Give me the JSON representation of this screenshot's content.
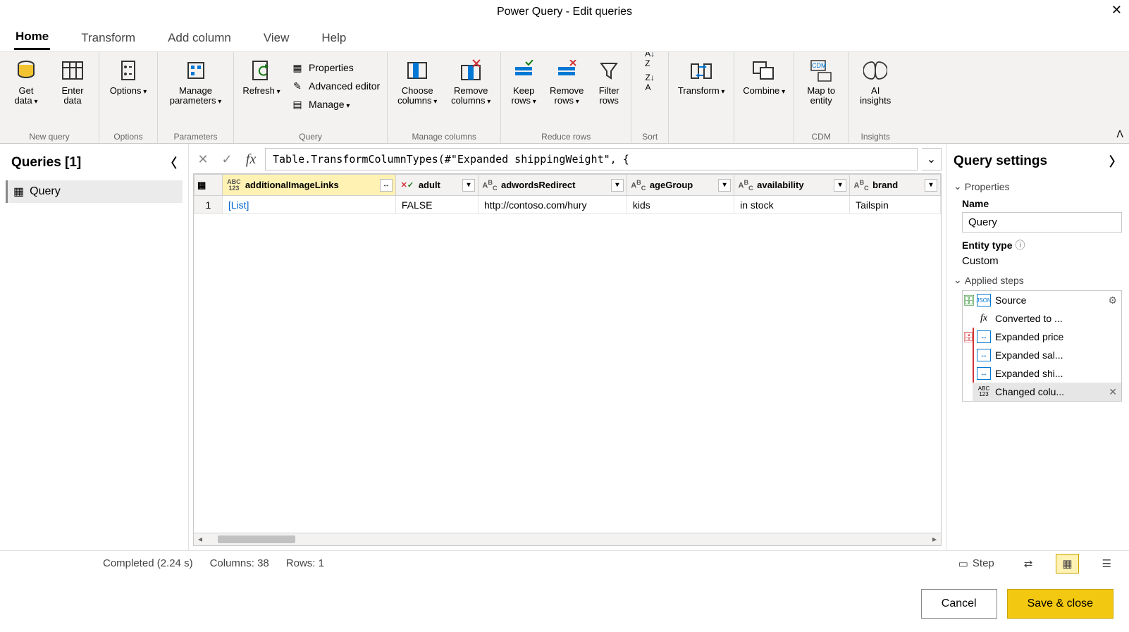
{
  "title": "Power Query - Edit queries",
  "tabs": [
    "Home",
    "Transform",
    "Add column",
    "View",
    "Help"
  ],
  "ribbon": {
    "groups": [
      {
        "label": "New query",
        "buttons": [
          {
            "id": "get-data",
            "label": "Get\ndata",
            "caret": true
          },
          {
            "id": "enter-data",
            "label": "Enter\ndata"
          }
        ]
      },
      {
        "label": "Options",
        "buttons": [
          {
            "id": "options",
            "label": "Options",
            "caret": true
          }
        ]
      },
      {
        "label": "Parameters",
        "buttons": [
          {
            "id": "manage-params",
            "label": "Manage\nparameters",
            "caret": true
          }
        ]
      },
      {
        "label": "Query",
        "buttons": [
          {
            "id": "refresh",
            "label": "Refresh",
            "caret": true
          }
        ],
        "stack": [
          {
            "id": "properties",
            "label": "Properties"
          },
          {
            "id": "adv-editor",
            "label": "Advanced editor"
          },
          {
            "id": "manage",
            "label": "Manage",
            "caret": true
          }
        ]
      },
      {
        "label": "Manage columns",
        "buttons": [
          {
            "id": "choose-cols",
            "label": "Choose\ncolumns",
            "caret": true
          },
          {
            "id": "remove-cols",
            "label": "Remove\ncolumns",
            "caret": true
          }
        ]
      },
      {
        "label": "Reduce rows",
        "buttons": [
          {
            "id": "keep-rows",
            "label": "Keep\nrows",
            "caret": true
          },
          {
            "id": "remove-rows",
            "label": "Remove\nrows",
            "caret": true
          },
          {
            "id": "filter-rows",
            "label": "Filter\nrows"
          }
        ]
      },
      {
        "label": "Sort",
        "buttons": [
          {
            "id": "sort",
            "label": ""
          }
        ]
      },
      {
        "label": "",
        "buttons": [
          {
            "id": "transform",
            "label": "Transform",
            "caret": true
          }
        ]
      },
      {
        "label": "",
        "buttons": [
          {
            "id": "combine",
            "label": "Combine",
            "caret": true
          }
        ]
      },
      {
        "label": "CDM",
        "buttons": [
          {
            "id": "map-entity",
            "label": "Map to\nentity"
          }
        ]
      },
      {
        "label": "Insights",
        "buttons": [
          {
            "id": "ai",
            "label": "AI\ninsights"
          }
        ]
      }
    ]
  },
  "queries_panel": {
    "title": "Queries [1]",
    "items": [
      "Query"
    ]
  },
  "formula_bar": {
    "text": "Table.TransformColumnTypes(#\"Expanded shippingWeight\", {"
  },
  "data_grid": {
    "columns": [
      {
        "name": "additionalImageLinks",
        "type": "ABC123",
        "highlight": true,
        "expand": true
      },
      {
        "name": "adult",
        "type": "bool"
      },
      {
        "name": "adwordsRedirect",
        "type": "text"
      },
      {
        "name": "ageGroup",
        "type": "text"
      },
      {
        "name": "availability",
        "type": "text"
      },
      {
        "name": "brand",
        "type": "text"
      }
    ],
    "rows": [
      {
        "n": "1",
        "cells": [
          "[List]",
          "FALSE",
          "http://contoso.com/hury",
          "kids",
          "in stock",
          "Tailspin"
        ]
      }
    ]
  },
  "query_settings": {
    "title": "Query settings",
    "properties_label": "Properties",
    "name_label": "Name",
    "name_value": "Query",
    "entity_type_label": "Entity type",
    "entity_type_value": "Custom",
    "applied_steps_label": "Applied steps",
    "steps": [
      {
        "label": "Source",
        "icon": "source",
        "gear": true,
        "side": "db-green"
      },
      {
        "label": "Converted to ...",
        "icon": "fx"
      },
      {
        "label": "Expanded price",
        "icon": "expand",
        "side": "db-red"
      },
      {
        "label": "Expanded sal...",
        "icon": "expand"
      },
      {
        "label": "Expanded shi...",
        "icon": "expand"
      },
      {
        "label": "Changed colu...",
        "icon": "abc",
        "selected": true,
        "del": true
      }
    ]
  },
  "status": {
    "completed": "Completed (2.24 s)",
    "columns": "Columns: 38",
    "rows": "Rows: 1",
    "step": "Step"
  },
  "footer": {
    "cancel": "Cancel",
    "save": "Save & close"
  }
}
